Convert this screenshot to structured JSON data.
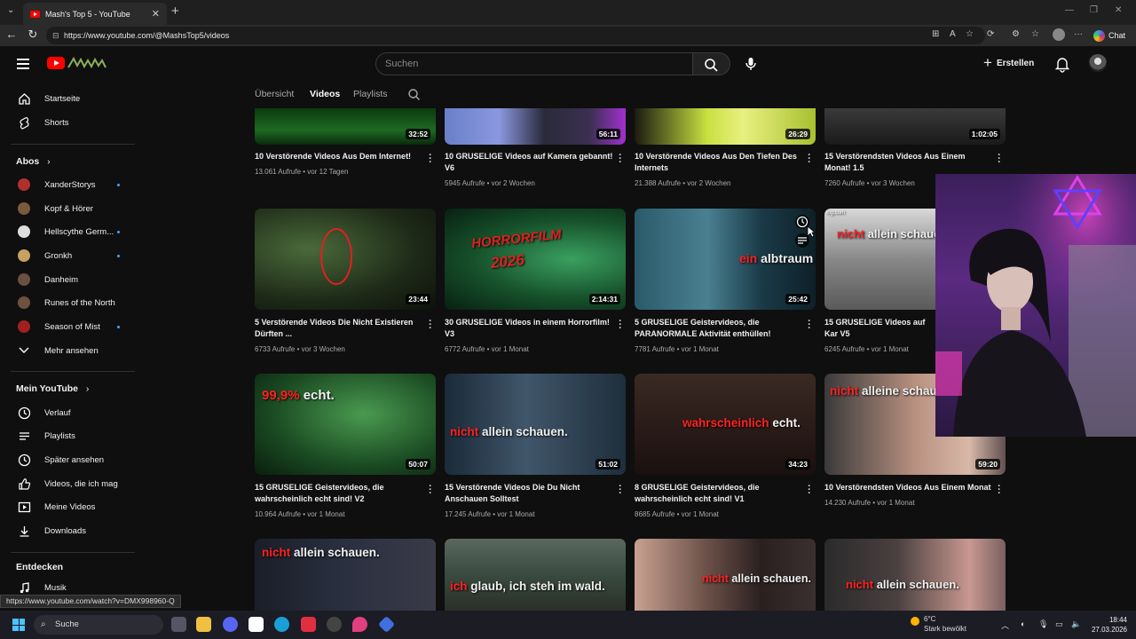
{
  "browser": {
    "tab_title": "Mash's Top 5 - YouTube",
    "url": "https://www.youtube.com/@MashsTop5/videos",
    "chat_label": "Chat",
    "status_url": "https://www.youtube.com/watch?v=DMX998960-Q"
  },
  "header": {
    "search_placeholder": "Suchen",
    "create_label": "Erstellen"
  },
  "sidebar": {
    "top": [
      {
        "label": "Startseite",
        "icon": "home-icon"
      },
      {
        "label": "Shorts",
        "icon": "shorts-icon"
      }
    ],
    "subs_title": "Abos",
    "subs": [
      {
        "label": "XanderStorys",
        "color": "#b03030"
      },
      {
        "label": "Kopf & Hörer",
        "color": "#7a5a3a"
      },
      {
        "label": "Hellscythe Germ...",
        "color": "#dddddd"
      },
      {
        "label": "Gronkh",
        "color": "#c8a060"
      },
      {
        "label": "Danheim",
        "color": "#6a5040"
      },
      {
        "label": "Runes of the North",
        "color": "#705040"
      },
      {
        "label": "Season of Mist",
        "color": "#a02020"
      }
    ],
    "more_label": "Mehr ansehen",
    "you_title": "Mein YouTube",
    "you": [
      {
        "label": "Verlauf",
        "icon": "history-icon"
      },
      {
        "label": "Playlists",
        "icon": "playlists-icon"
      },
      {
        "label": "Später ansehen",
        "icon": "watch-later-icon"
      },
      {
        "label": "Videos, die ich mag",
        "icon": "like-icon"
      },
      {
        "label": "Meine Videos",
        "icon": "my-videos-icon"
      },
      {
        "label": "Downloads",
        "icon": "download-icon"
      }
    ],
    "explore_title": "Entdecken",
    "explore": [
      {
        "label": "Musik",
        "icon": "music-icon"
      }
    ]
  },
  "tabs": [
    "Übersicht",
    "Videos",
    "Playlists"
  ],
  "videos": [
    {
      "title": "10 Verstörende Videos Aus Dem Internet!",
      "views": "13.061 Aufrufe",
      "age": "vor 12 Tagen",
      "duration": "32:52"
    },
    {
      "title": "10 GRUSELIGE Videos auf Kamera gebannt! V6",
      "views": "5945 Aufrufe",
      "age": "vor 2 Wochen",
      "duration": "56:11"
    },
    {
      "title": "10 Verstörende Videos Aus Den Tiefen Des Internets",
      "views": "21.388 Aufrufe",
      "age": "vor 2 Wochen",
      "duration": "26:29"
    },
    {
      "title": "15 Verstörendsten Videos Aus Einem Monat! 1.5",
      "views": "7260 Aufrufe",
      "age": "vor 3 Wochen",
      "duration": "1:02:05"
    },
    {
      "title": "5 Verstörende Videos Die Nicht Existieren Dürften ...",
      "views": "6733 Aufrufe",
      "age": "vor 3 Wochen",
      "duration": "23:44"
    },
    {
      "title": "30 GRUSELIGE Videos in einem Horrorfilm! V3",
      "views": "6772 Aufrufe",
      "age": "vor 1 Monat",
      "duration": "2:14:31"
    },
    {
      "title": "5 GRUSELIGE Geistervideos, die PARANORMALE Aktivität enthüllen!",
      "views": "7781 Aufrufe",
      "age": "vor 1 Monat",
      "duration": "25:42"
    },
    {
      "title": "15 GRUSELIGE Videos auf Kar V5",
      "views": "6245 Aufrufe",
      "age": "vor 1 Monat",
      "duration": ""
    },
    {
      "title": "15 GRUSELIGE Geistervideos, die wahrscheinlich echt sind! V2",
      "views": "10.964 Aufrufe",
      "age": "vor 1 Monat",
      "duration": "50:07"
    },
    {
      "title": "15 Verstörende Videos Die Du Nicht Anschauen Solltest",
      "views": "17.245 Aufrufe",
      "age": "vor 1 Monat",
      "duration": "51:02"
    },
    {
      "title": "8 GRUSELIGE Geistervideos, die wahrscheinlich echt sind! V1",
      "views": "8685 Aufrufe",
      "age": "vor 1 Monat",
      "duration": "34:23"
    },
    {
      "title": "10 Verstörendsten Videos Aus Einem Monat",
      "views": "14.230 Aufrufe",
      "age": "vor 1 Monat",
      "duration": "59:20"
    },
    {
      "title": "",
      "views": "",
      "age": "",
      "duration": ""
    },
    {
      "title": "",
      "views": "",
      "age": "",
      "duration": ""
    },
    {
      "title": "",
      "views": "",
      "age": "",
      "duration": ""
    },
    {
      "title": "",
      "views": "",
      "age": "",
      "duration": ""
    }
  ],
  "thumb_text": {
    "horrorfilm_line1": "HORRORFILM",
    "horrorfilm_line2": "2026",
    "ein": "ein",
    "albtraum": "albtraum",
    "nicht": "nicht",
    "allein_schaue": "allein schaue",
    "p99": "99,9%",
    "echt": "echt.",
    "allein_schauen": "allein schauen.",
    "wahrscheinlich": "wahrscheinlich",
    "alleine_schau": "alleine schau",
    "ich": "ich",
    "glaub": "glaub, ich steh im wald.",
    "ing_com": "ing.com"
  },
  "taskbar": {
    "search": "Suche",
    "weather_temp": "6°C",
    "weather_desc": "Stark bewölkt",
    "time": "18:44",
    "date": "27.03.2026"
  }
}
